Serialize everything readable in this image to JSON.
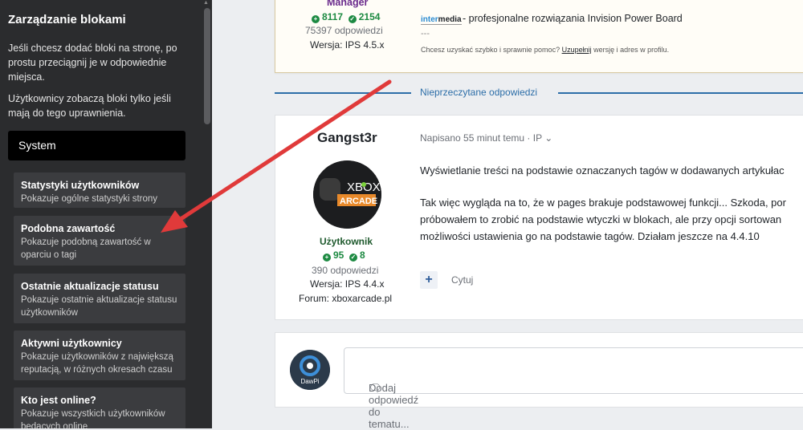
{
  "sidebar": {
    "title": "Zarządzanie blokami",
    "desc1": [
      "Jeśli chcesz dodać bloki na stronę, po",
      "prostu przeciągnij je w odpowiednie",
      "miejsca."
    ],
    "desc2": [
      "Użytkownicy zobaczą bloki tylko jeśli",
      "mają do tego uprawnienia."
    ],
    "section": "System",
    "widgets": [
      {
        "title": "Statystyki użytkowników",
        "desc": "Pokazuje ogólne statystyki strony"
      },
      {
        "title": "Podobna zawartość",
        "desc": "Pokazuje podobną zawartość w oparciu o tagi"
      },
      {
        "title": "Ostatnie aktualizacje statusu",
        "desc": "Pokazuje ostatnie aktualizacje statusu użytkowników"
      },
      {
        "title": "Aktywni użytkownicy",
        "desc": "Pokazuje użytkowników z największą reputacją, w różnych okresach czasu"
      },
      {
        "title": "Kto jest online?",
        "desc": "Pokazuje wszystkich użytkowników będących online"
      }
    ]
  },
  "post1": {
    "role": "Manager",
    "rep_pos": "8117",
    "rep_neg": "2154",
    "answers": "75397 odpowiedzi",
    "version": "Wersja: IPS 4.5.x",
    "logo_a": "inter",
    "logo_b": "media",
    "sig": "- profesjonalne rozwiązania Invision Power Board",
    "sig_dash": "---",
    "help_pre": "Chcesz uzyskać szybko i sprawnie pomoc? ",
    "help_link": "Uzupełnij",
    "help_post": " wersję i adres w profilu."
  },
  "separator": "Nieprzeczytane odpowiedzi",
  "post2": {
    "author": "Gangst3r",
    "avatar_top": "XBOX",
    "avatar_bottom": "ARCADE",
    "role": "Użytkownik",
    "rep_pos": "95",
    "rep_neg": "8",
    "answers": "390 odpowiedzi",
    "version": "Wersja: IPS 4.4.x",
    "forum": "Forum: xboxarcade.pl",
    "meta": "Napisano 55 minut temu · IP ⌄",
    "line1": "Wyświetlanie treści na podstawie oznaczanych tagów w dodawanych artykułac",
    "line2": "Tak więc wygląda na to, że w pages brakuje podstawowej funkcji... Szkoda, por",
    "line3": "próbowałem to zrobić na podstawie wtyczki w blokach, ale przy opcji sortowan",
    "line4": "możliwości ustawienia go na podstawie tagów. Działam jeszcze na 4.4.10",
    "plus": "+",
    "quote": "Cytuj"
  },
  "reply": {
    "avatar_label": "DawPi",
    "placeholder": "Dodaj odpowiedź do tematu..."
  },
  "colors": {
    "accent": "#2d6ea8",
    "rep": "#1d8a42",
    "arrow": "#e03a3a"
  }
}
